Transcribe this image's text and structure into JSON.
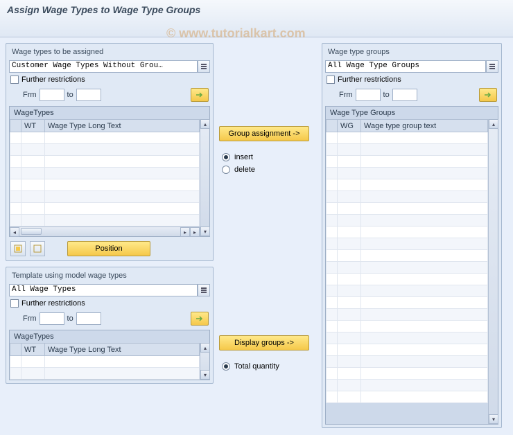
{
  "header": {
    "title": "Assign Wage Types to Wage Type Groups"
  },
  "watermark": "© www.tutorialkart.com",
  "left_top": {
    "title": "Wage types to be assigned",
    "dropdown": "Customer Wage Types Without Grou…",
    "further_label": "Further restrictions",
    "frm_label": "Frm",
    "to_label": "to",
    "table_title": "WageTypes",
    "col1": "WT",
    "col2": "Wage Type Long Text",
    "position_label": "Position"
  },
  "left_bottom": {
    "title": "Template using model wage types",
    "dropdown": "All Wage Types",
    "further_label": "Further restrictions",
    "frm_label": "Frm",
    "to_label": "to",
    "table_title": "WageTypes",
    "col1": "WT",
    "col2": "Wage Type Long Text"
  },
  "mid": {
    "group_assign": "Group assignment ->",
    "insert": "insert",
    "delete": "delete",
    "display_groups": "Display groups ->",
    "total_quantity": "Total quantity"
  },
  "right": {
    "title": "Wage type groups",
    "dropdown": "All Wage Type Groups",
    "further_label": "Further restrictions",
    "frm_label": "Frm",
    "to_label": "to",
    "table_title": "Wage Type Groups",
    "col1": "WG",
    "col2": "Wage type group text"
  }
}
